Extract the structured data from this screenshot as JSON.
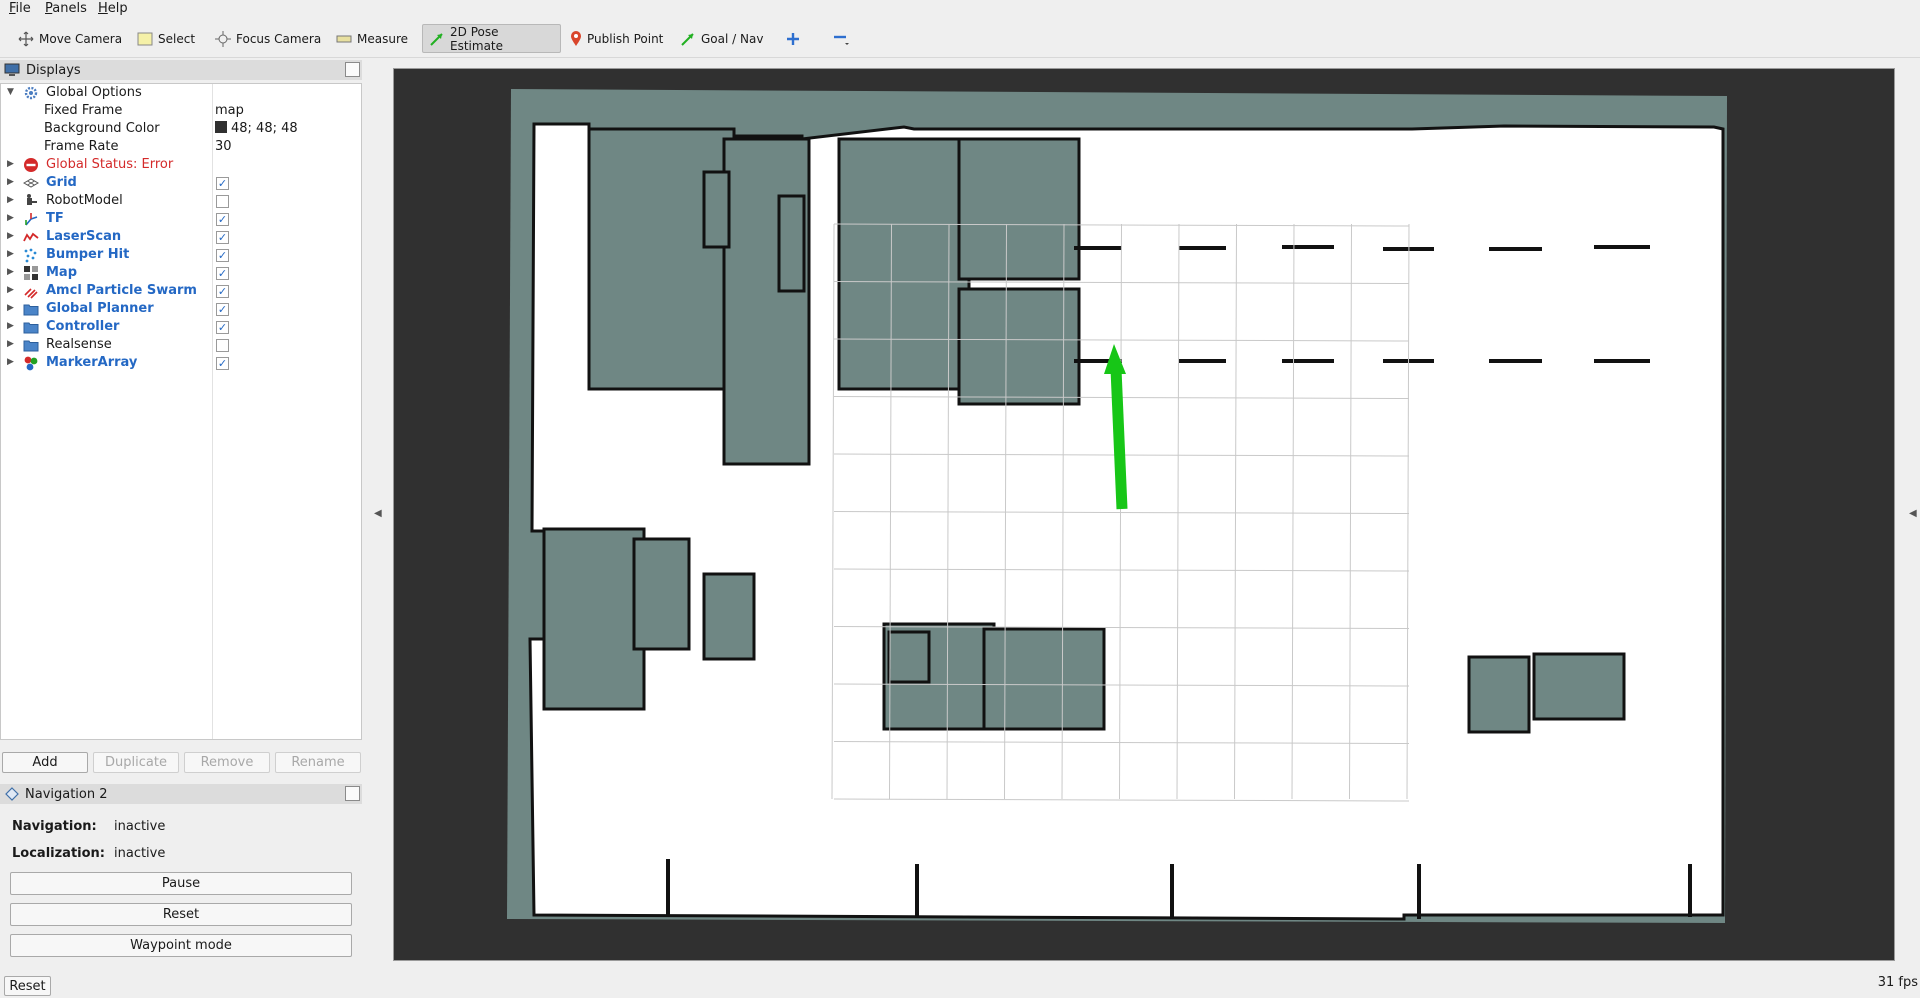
{
  "menu": [
    "File",
    "Panels",
    "Help"
  ],
  "toolbar": {
    "tools": [
      {
        "label": "Move Camera",
        "icon": "move-camera-icon"
      },
      {
        "label": "Select",
        "icon": "select-icon"
      },
      {
        "label": "Focus Camera",
        "icon": "focus-camera-icon"
      },
      {
        "label": "Measure",
        "icon": "measure-icon"
      },
      {
        "label": "2D Pose Estimate",
        "icon": "pose-estimate-icon",
        "active": true
      },
      {
        "label": "Publish Point",
        "icon": "publish-point-icon"
      },
      {
        "label": "Goal / Nav",
        "icon": "goal-nav-icon"
      },
      {
        "label": "",
        "icon": "add-tool-icon"
      },
      {
        "label": "",
        "icon": "remove-tool-icon"
      }
    ]
  },
  "displays": {
    "title": "Displays",
    "global_options": {
      "label": "Global Options",
      "fixed_frame_label": "Fixed Frame",
      "fixed_frame": "map",
      "background_color_label": "Background Color",
      "background_color": "48; 48; 48",
      "background_hex": "#303030",
      "frame_rate_label": "Frame Rate",
      "frame_rate": "30"
    },
    "items": [
      {
        "label": "Global Status: Error",
        "style": "error",
        "icon": "error-icon",
        "checkbox": null
      },
      {
        "label": "Grid",
        "style": "blue",
        "icon": "grid-icon",
        "checked": true
      },
      {
        "label": "RobotModel",
        "style": "normal",
        "icon": "robot-model-icon",
        "checked": false
      },
      {
        "label": "TF",
        "style": "blue",
        "icon": "tf-icon",
        "checked": true
      },
      {
        "label": "LaserScan",
        "style": "blue",
        "icon": "laser-scan-icon",
        "checked": true
      },
      {
        "label": "Bumper Hit",
        "style": "blue",
        "icon": "bumper-hit-icon",
        "checked": true
      },
      {
        "label": "Map",
        "style": "blue",
        "icon": "map-icon",
        "checked": true
      },
      {
        "label": "Amcl Particle Swarm",
        "style": "blue",
        "icon": "particle-swarm-icon",
        "checked": true
      },
      {
        "label": "Global Planner",
        "style": "blue",
        "icon": "folder-icon",
        "checked": true
      },
      {
        "label": "Controller",
        "style": "blue",
        "icon": "folder-icon",
        "checked": true
      },
      {
        "label": "Realsense",
        "style": "normal",
        "icon": "folder-icon",
        "checked": false
      },
      {
        "label": "MarkerArray",
        "style": "blue",
        "icon": "marker-array-icon",
        "checked": true
      }
    ],
    "buttons": {
      "add": "Add",
      "duplicate": "Duplicate",
      "remove": "Remove",
      "rename": "Rename"
    }
  },
  "navigation": {
    "title": "Navigation 2",
    "navigation_label": "Navigation:",
    "navigation_value": "inactive",
    "localization_label": "Localization:",
    "localization_value": "inactive",
    "pause": "Pause",
    "reset": "Reset",
    "waypoint": "Waypoint mode"
  },
  "status": {
    "reset": "Reset",
    "fps": "31 fps"
  },
  "colors": {
    "occupied": "#000000",
    "unknown": "#6f8784",
    "free": "#ffffff",
    "pose_arrow": "#1fd11f",
    "blue_label": "#2468c4",
    "error_label": "#d42a2a"
  }
}
